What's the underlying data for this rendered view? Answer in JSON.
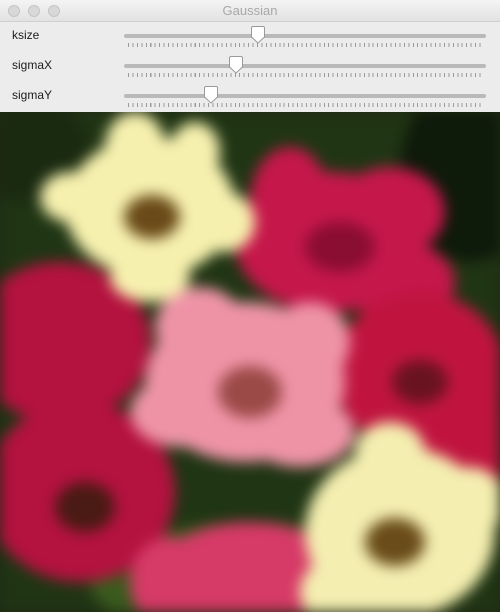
{
  "window": {
    "title": "Gaussian"
  },
  "trackbars": [
    {
      "label": "ksize",
      "value_fraction": 0.37
    },
    {
      "label": "sigmaX",
      "value_fraction": 0.31
    },
    {
      "label": "sigmaY",
      "value_fraction": 0.24
    }
  ],
  "image": {
    "subject": "blurred-flowers"
  }
}
